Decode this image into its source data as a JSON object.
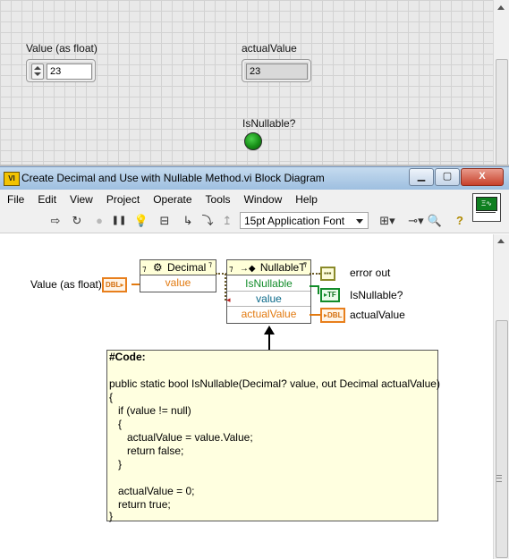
{
  "front_panel": {
    "control": {
      "label": "Value (as float)",
      "value": "23"
    },
    "indicator": {
      "label": "actualValue",
      "value": "23"
    },
    "led": {
      "label": "IsNullable?",
      "state": "on",
      "color": "#1f9a1f"
    }
  },
  "window": {
    "title": "Create Decimal and Use with Nullable Method.vi Block Diagram",
    "app_icon_text": "VI",
    "buttons": {
      "minimize": "▁",
      "maximize": "▢",
      "close": "X"
    }
  },
  "menu": [
    "File",
    "Edit",
    "View",
    "Project",
    "Operate",
    "Tools",
    "Window",
    "Help"
  ],
  "toolbar": {
    "font_select": "15pt Application Font",
    "icons": [
      "run-arrow-icon",
      "run-continuously-icon",
      "abort-icon",
      "pause-icon",
      "highlight-execution-icon",
      "retain-wire-values-icon",
      "step-into-icon",
      "step-over-icon",
      "step-out-icon",
      "align-icon",
      "distribute-icon",
      "search-icon",
      "help-icon"
    ],
    "glyphs": {
      "run": "⇨",
      "runcont": "↻",
      "abort": "●",
      "pause": "❚❚",
      "bulb": "💡",
      "retain": "⊟",
      "step_into": "↳",
      "step_over": "⤵",
      "step_out": "↥",
      "align": "⊞▾",
      "distribute": "⊸▾",
      "search": "🔍",
      "help": "?"
    }
  },
  "context_help_icon": {
    "text": "Ξ∿"
  },
  "diagram": {
    "control_label": "Value (as float)",
    "dbl_tag": "DBL",
    "tf_tag": "TF",
    "error_tag": "▪▪▪",
    "decimal_node": {
      "title": "Decimal",
      "glyph": "⚙",
      "input": "value"
    },
    "nullable_node": {
      "title": "NullableT",
      "glyph": "→◆",
      "outputs": [
        "IsNullable",
        "value",
        "actualValue"
      ]
    },
    "outputs": {
      "error_out": "error out",
      "is_nullable": "IsNullable?",
      "actual_value": "actualValue"
    },
    "comment_lines": [
      "#Code:",
      "",
      "public static bool IsNullable(Decimal? value, out Decimal actualValue)",
      "{",
      "   if (value != null)",
      "   {",
      "      actualValue = value.Value;",
      "      return false;",
      "   }",
      "",
      "   actualValue = 0;",
      "   return true;",
      "}"
    ]
  },
  "colors": {
    "numeric_wire": "#e27a10",
    "boolean_wire": "#128c2a",
    "comment_bg": "#ffffe0",
    "titlebar": "#b5cfe9"
  }
}
